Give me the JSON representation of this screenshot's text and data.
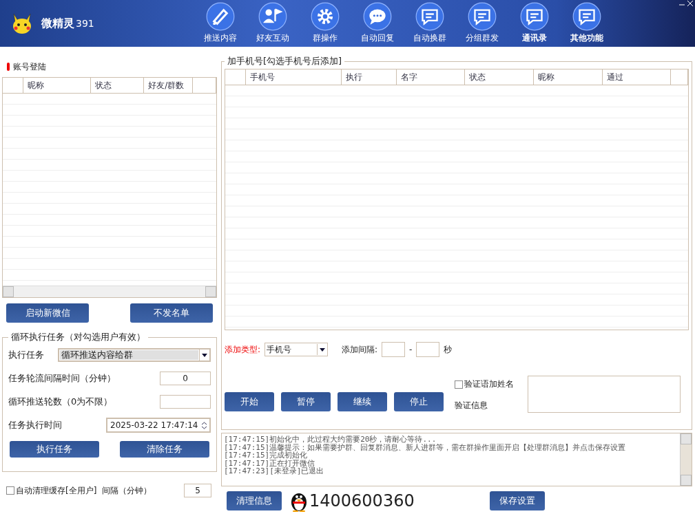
{
  "app": {
    "title": "微精灵",
    "version": "391"
  },
  "nav": [
    {
      "label": "推送内容",
      "bold": false
    },
    {
      "label": "好友互动",
      "bold": false
    },
    {
      "label": "群操作",
      "bold": false
    },
    {
      "label": "自动回复",
      "bold": false
    },
    {
      "label": "自动换群",
      "bold": false
    },
    {
      "label": "分组群发",
      "bold": false
    },
    {
      "label": "通讯录",
      "bold": true
    },
    {
      "label": "其他功能",
      "bold": true
    }
  ],
  "accounts": {
    "title": "账号登陆",
    "columns": [
      "昵称",
      "状态",
      "好友/群数"
    ],
    "buttons": [
      "启动新微信",
      "不发名单"
    ]
  },
  "loop_task": {
    "title": "循环执行任务（对勾选用户有效）",
    "task_label": "执行任务",
    "task_value": "循环推送内容给群",
    "interval_label": "任务轮流间隔时间（分钟）",
    "interval_value": "0",
    "rounds_label": "循环推送轮数（0为不限）",
    "time_label": "任务执行时间",
    "time_value": "2025-03-22 17:47:14",
    "buttons": [
      "执行任务",
      "清除任务"
    ]
  },
  "auto_clear": {
    "label": "自动清理缓存[全用户]",
    "checked": false,
    "interval_label": "间隔（分钟）",
    "interval_value": "5"
  },
  "add_phone": {
    "title": "加手机号[勾选手机号后添加]",
    "columns": [
      "手机号",
      "执行",
      "名字",
      "状态",
      "昵称",
      "通过"
    ],
    "type_label": "添加类型:",
    "type_value": "手机号",
    "interval_label": "添加间隔:",
    "dash": "-",
    "unit": "秒",
    "buttons": [
      "开始",
      "暂停",
      "继续",
      "停止"
    ],
    "name_check": {
      "label": "验证语加姓名",
      "checked": false
    },
    "verify_label": "验证信息"
  },
  "log": [
    "[17:47:15]初始化中，此过程大约需要20秒，请耐心等待...",
    "[17:47:15]温馨提示：如果需要护群、回复群消息、新人进群等，需在群操作里面开启【处理群消息】并点击保存设置",
    "[17:47:15]完成初始化",
    "[17:47:17]正在打开微信",
    "[17:47:23][未登录]已退出"
  ],
  "footer": {
    "clear_button": "清理信息",
    "qq": "1400600360",
    "save_button": "保存设置"
  }
}
